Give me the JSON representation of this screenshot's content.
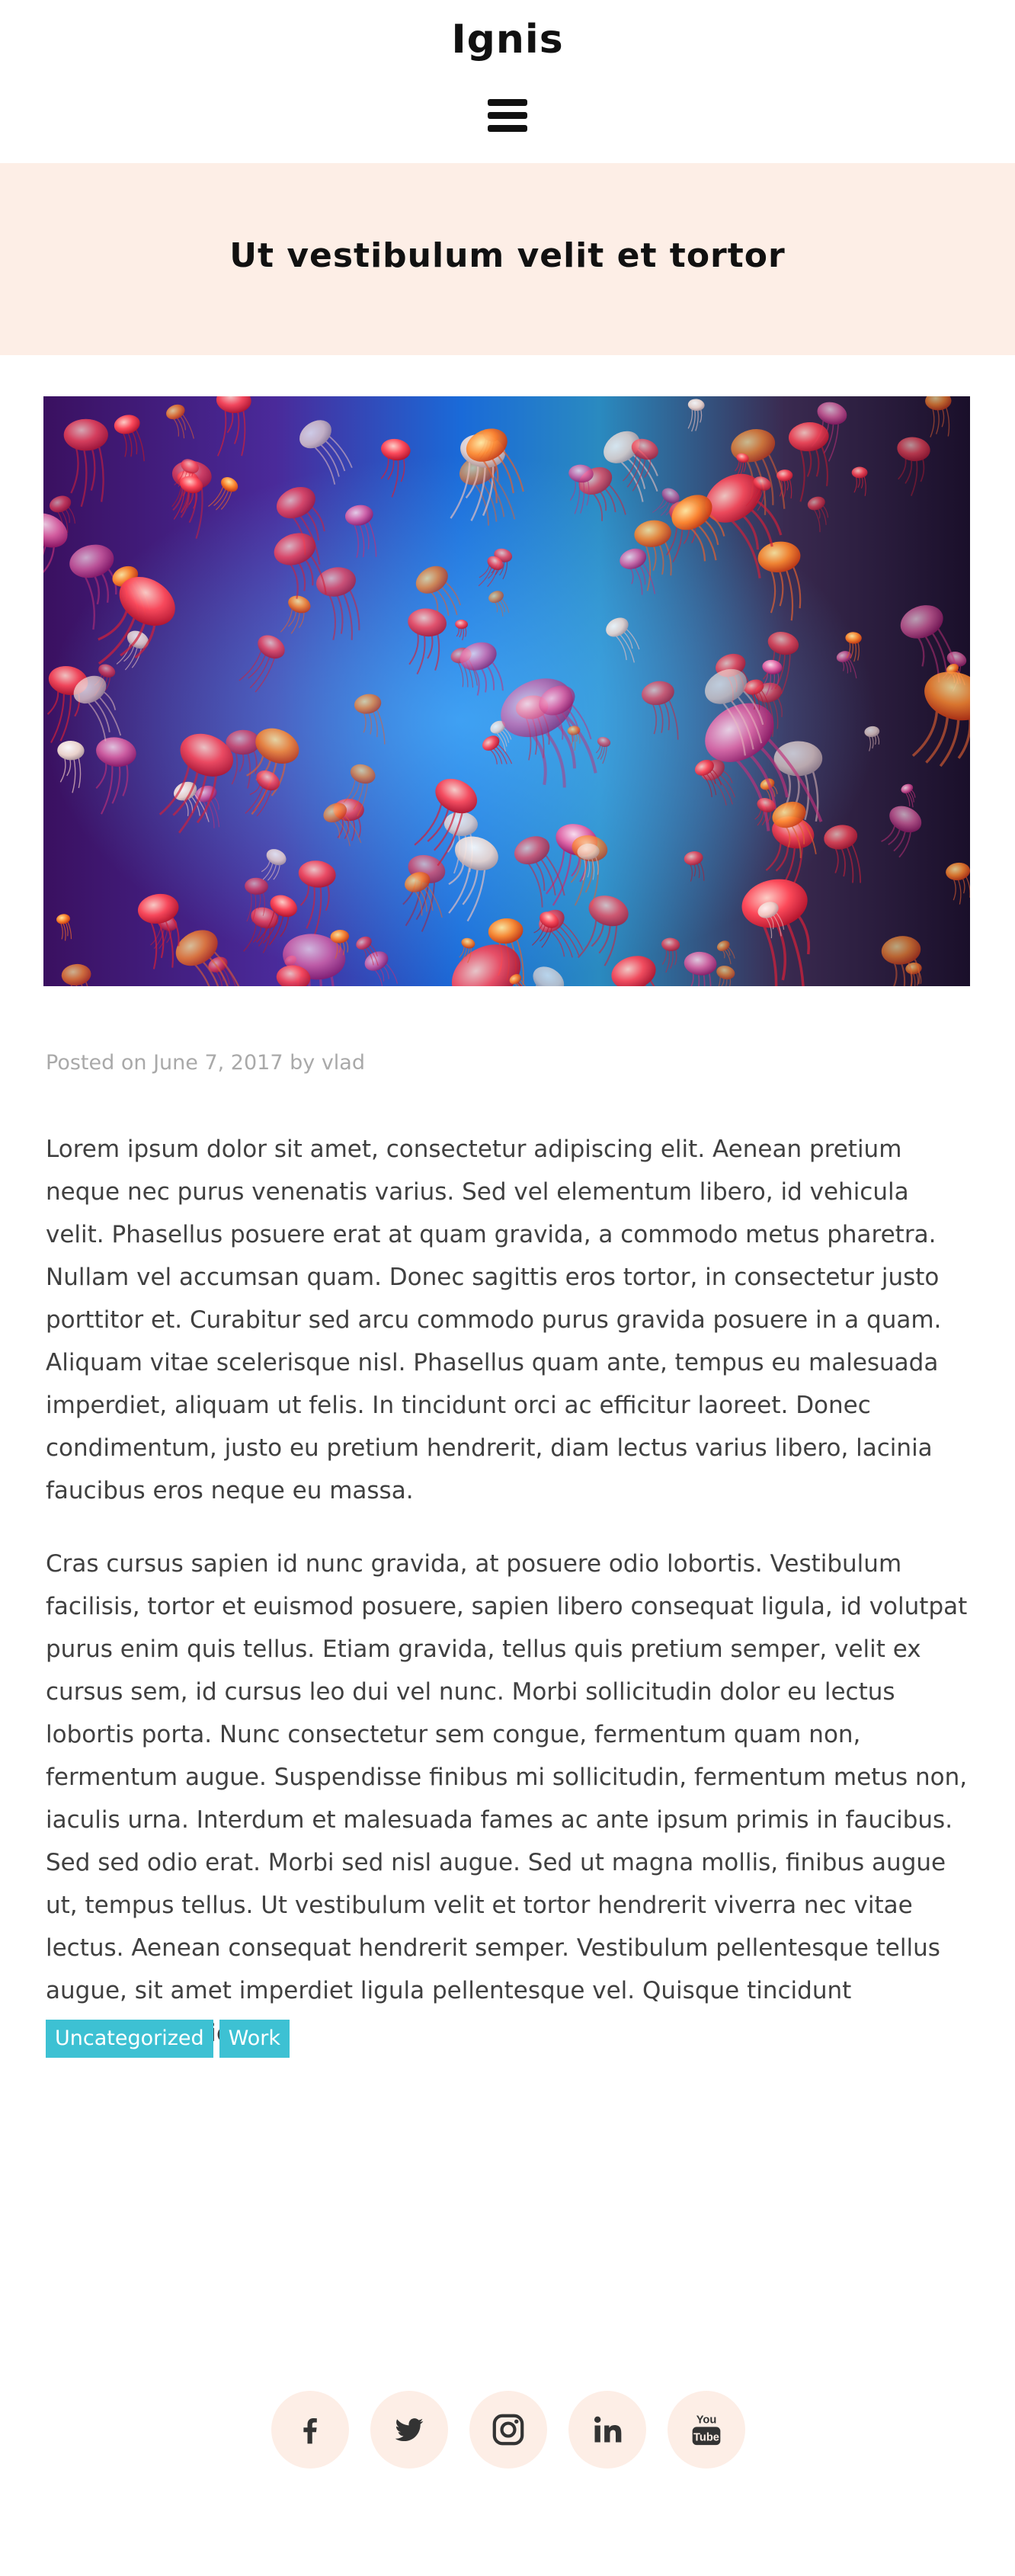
{
  "header": {
    "site_title": "Ignis",
    "menu_icon": "hamburger-menu-icon"
  },
  "page": {
    "title": "Ut vestibulum velit et tortor"
  },
  "post": {
    "meta": {
      "posted_on_prefix": "Posted on",
      "date": "June 7, 2017",
      "by_prefix": "by",
      "author": "vlad"
    },
    "paragraphs": [
      "Lorem ipsum dolor sit amet, consectetur adipiscing elit. Aenean pretium neque nec purus venenatis varius. Sed vel elementum libero, id vehicula velit. Phasellus posuere erat at quam gravida, a commodo metus pharetra. Nullam vel accumsan quam. Donec sagittis eros tortor, in consectetur justo porttitor et. Curabitur sed arcu commodo purus gravida posuere in a quam. Aliquam vitae scelerisque nisl. Phasellus quam ante, tempus eu malesuada imperdiet, aliquam ut felis. In tincidunt orci ac efficitur laoreet. Donec condimentum, justo eu pretium hendrerit, diam lectus varius libero, lacinia faucibus eros neque eu massa.",
      "Cras cursus sapien id nunc gravida, at posuere odio lobortis. Vestibulum facilisis, tortor et euismod posuere, sapien libero consequat ligula, id volutpat purus enim quis tellus. Etiam gravida, tellus quis pretium semper, velit ex cursus sem, id cursus leo dui vel nunc. Morbi sollicitudin dolor eu lectus lobortis porta. Nunc consectetur sem congue, fermentum quam non, fermentum augue. Suspendisse finibus mi sollicitudin, fermentum metus non, iaculis urna. Interdum et malesuada fames ac ante ipsum primis in faucibus. Sed sed odio erat. Morbi sed nisl augue. Sed ut magna mollis, finibus augue ut, tempus tellus. Ut vestibulum velit et tortor hendrerit viverra nec vitae lectus. Aenean consequat hendrerit semper. Vestibulum pellentesque tellus augue, sit amet imperdiet ligula pellentesque vel. Quisque tincidunt vulputate vehicula."
    ],
    "tags": [
      "Uncategorized",
      "Work"
    ]
  },
  "footer": {
    "social": [
      {
        "icon": "facebook-icon"
      },
      {
        "icon": "twitter-icon"
      },
      {
        "icon": "instagram-icon"
      },
      {
        "icon": "linkedin-icon"
      },
      {
        "icon": "youtube-icon",
        "logo_text_top": "You",
        "logo_text_bottom": "Tube"
      }
    ]
  },
  "colors": {
    "accent": "#3dc1d3",
    "banner_bg": "#fdeee6",
    "meta_text": "#a9a9a9",
    "body_text": "#404040",
    "icon_color": "#333333"
  }
}
